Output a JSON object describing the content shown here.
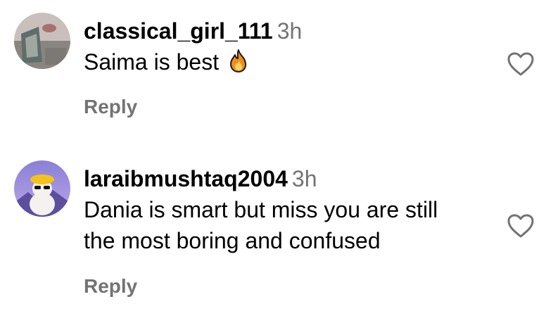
{
  "comments": [
    {
      "username": "classical_girl_111",
      "time": "3h",
      "text": "Saima is best",
      "emoji": "fire-emoji",
      "reply_label": "Reply"
    },
    {
      "username": "laraibmushtaq2004",
      "time": "3h",
      "text_line1": "Dania is smart but miss you are still",
      "text_line2": "the most boring and confused",
      "reply_label": "Reply"
    }
  ],
  "colors": {
    "primary_text": "#000000",
    "secondary_text": "#737373",
    "background": "#ffffff"
  },
  "icons": {
    "like": "heart-outline-icon",
    "emoji": "fire-emoji"
  }
}
